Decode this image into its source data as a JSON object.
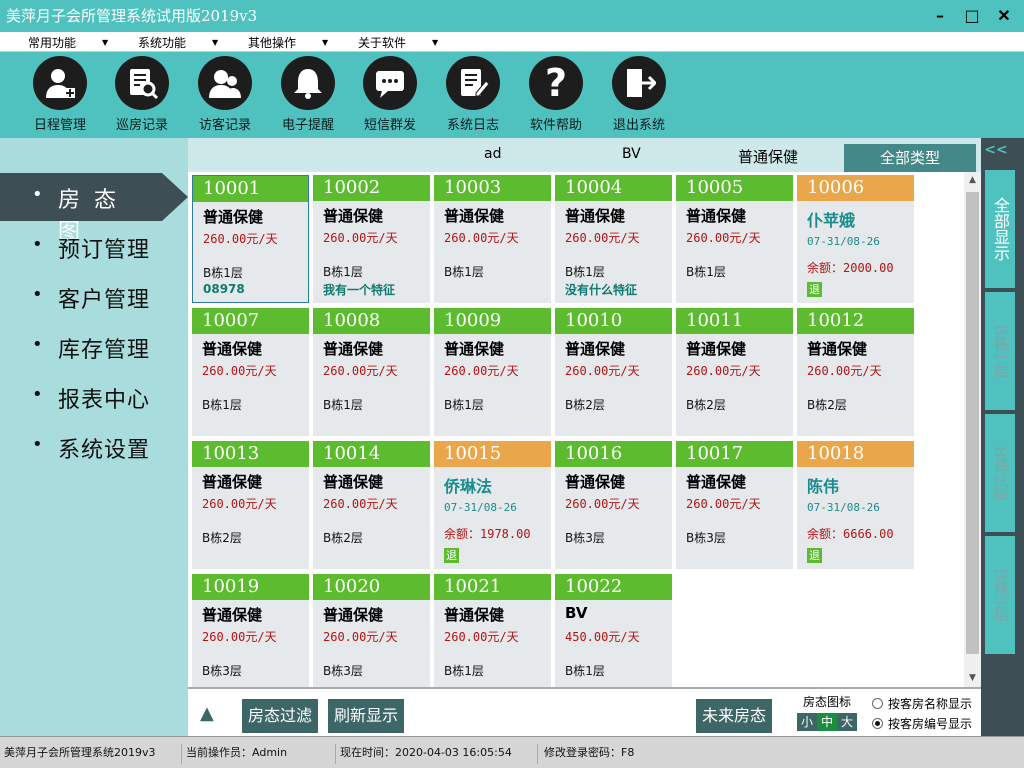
{
  "window": {
    "title": "美萍月子会所管理系统试用版2019v3"
  },
  "menu": [
    "常用功能",
    "系统功能",
    "其他操作",
    "关于软件"
  ],
  "toolbar": [
    "日程管理",
    "巡房记录",
    "访客记录",
    "电子提醒",
    "短信群发",
    "系统日志",
    "软件帮助",
    "退出系统"
  ],
  "sidebar": [
    "房态图",
    "预订管理",
    "客户管理",
    "库存管理",
    "报表中心",
    "系统设置"
  ],
  "filters": [
    "ad",
    "BV",
    "普通保健",
    "全部类型"
  ],
  "rooms": [
    {
      "no": "10001",
      "type": "普通保健",
      "price": "260.00元/天",
      "floor": "B栋1层",
      "note": "08978"
    },
    {
      "no": "10002",
      "type": "普通保健",
      "price": "260.00元/天",
      "floor": "B栋1层",
      "note": "我有一个特征"
    },
    {
      "no": "10003",
      "type": "普通保健",
      "price": "260.00元/天",
      "floor": "B栋1层",
      "note": ""
    },
    {
      "no": "10004",
      "type": "普通保健",
      "price": "260.00元/天",
      "floor": "B栋1层",
      "note": "没有什么特征"
    },
    {
      "no": "10005",
      "type": "普通保健",
      "price": "260.00元/天",
      "floor": "B栋1层",
      "note": ""
    },
    {
      "no": "10006",
      "guest": "仆苹娥",
      "dates": "07-31/08-26",
      "balance": "余额：2000.00",
      "checkout": "退"
    },
    {
      "no": "10007",
      "type": "普通保健",
      "price": "260.00元/天",
      "floor": "B栋1层",
      "note": ""
    },
    {
      "no": "10008",
      "type": "普通保健",
      "price": "260.00元/天",
      "floor": "B栋1层",
      "note": ""
    },
    {
      "no": "10009",
      "type": "普通保健",
      "price": "260.00元/天",
      "floor": "B栋1层",
      "note": ""
    },
    {
      "no": "10010",
      "type": "普通保健",
      "price": "260.00元/天",
      "floor": "B栋2层",
      "note": ""
    },
    {
      "no": "10011",
      "type": "普通保健",
      "price": "260.00元/天",
      "floor": "B栋2层",
      "note": ""
    },
    {
      "no": "10012",
      "type": "普通保健",
      "price": "260.00元/天",
      "floor": "B栋2层",
      "note": ""
    },
    {
      "no": "10013",
      "type": "普通保健",
      "price": "260.00元/天",
      "floor": "B栋2层",
      "note": ""
    },
    {
      "no": "10014",
      "type": "普通保健",
      "price": "260.00元/天",
      "floor": "B栋2层",
      "note": ""
    },
    {
      "no": "10015",
      "guest": "侨琳法",
      "dates": "07-31/08-26",
      "balance": "余额：1978.00",
      "checkout": "退"
    },
    {
      "no": "10016",
      "type": "普通保健",
      "price": "260.00元/天",
      "floor": "B栋3层",
      "note": ""
    },
    {
      "no": "10017",
      "type": "普通保健",
      "price": "260.00元/天",
      "floor": "B栋3层",
      "note": ""
    },
    {
      "no": "10018",
      "guest": "陈伟",
      "dates": "07-31/08-26",
      "balance": "余额：6666.00",
      "checkout": "退"
    },
    {
      "no": "10019",
      "type": "普通保健",
      "price": "260.00元/天",
      "floor": "B栋3层",
      "note": ""
    },
    {
      "no": "10020",
      "type": "普通保健",
      "price": "260.00元/天",
      "floor": "B栋3层",
      "note": ""
    },
    {
      "no": "10021",
      "type": "普通保健",
      "price": "260.00元/天",
      "floor": "B栋1层",
      "note": ""
    },
    {
      "no": "10022",
      "type": "BV",
      "price": "450.00元/天",
      "floor": "B栋1层",
      "note": ""
    }
  ],
  "bottom": {
    "filter_btn": "房态过滤",
    "refresh_btn": "刷新显示",
    "future_btn": "未来房态",
    "icon_label": "房态图标",
    "sizes": [
      "小",
      "中",
      "大"
    ],
    "radio_name": "按客房名称显示",
    "radio_number": "按客房编号显示"
  },
  "rightpanel": {
    "collapse": "<<",
    "tabs": [
      "全部显示",
      "B栋1层",
      "B栋2层",
      "B栋3层"
    ]
  },
  "status": [
    "美萍月子会所管理系统2019v3",
    "当前操作员：Admin",
    "现在时间：2020-04-03 16:05:54",
    "修改登录密码：F8"
  ]
}
